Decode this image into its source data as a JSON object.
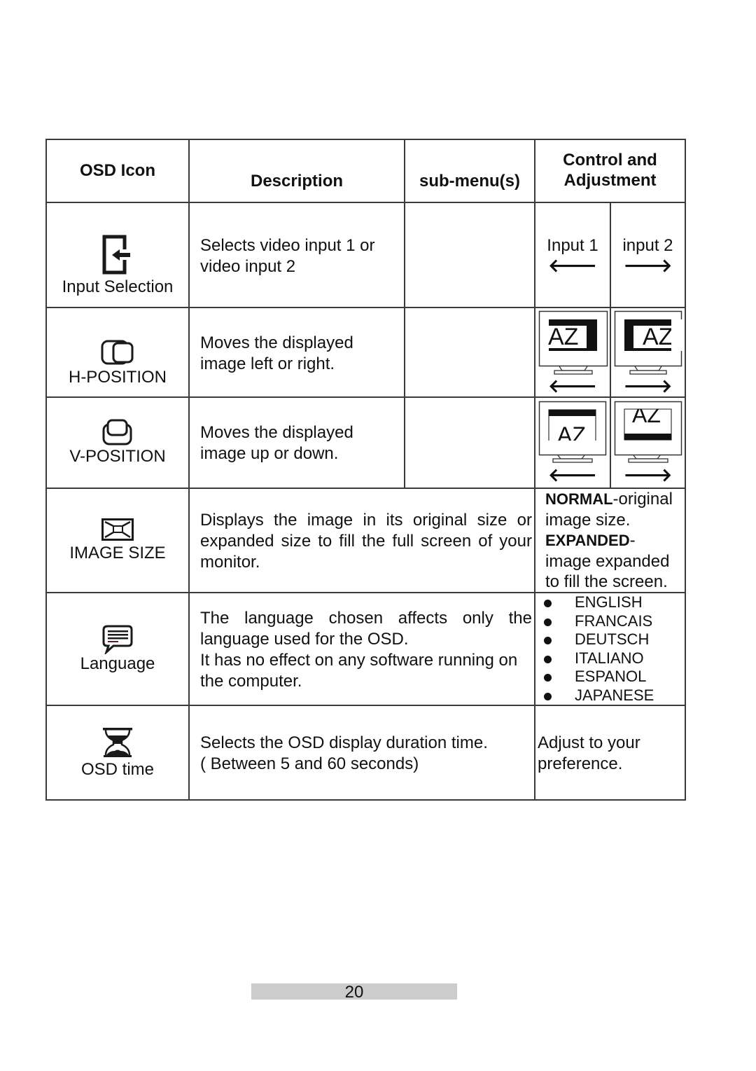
{
  "table": {
    "headers": {
      "osd_icon": "OSD Icon",
      "description": "Description",
      "submenus": "sub-menu(s)",
      "control_line1": "Control and",
      "control_line2": "Adjustment"
    },
    "rows": [
      {
        "icon": "input-selection-icon",
        "label": "Input Selection",
        "description_lines": [
          "Selects video input 1 or",
          "video input 2"
        ],
        "submenus": "",
        "controls": [
          {
            "label": "Input 1",
            "arrow": "🡐",
            "arrow_name": "left-arrow-icon"
          },
          {
            "label": "input 2",
            "arrow": "🡒",
            "arrow_name": "right-arrow-icon"
          }
        ]
      },
      {
        "icon": "h-position-icon",
        "label": "H-POSITION",
        "description_lines": [
          "Moves the displayed",
          "image left or right."
        ],
        "submenus": "",
        "controls": [
          {
            "illustration": "monitor-shifted-left",
            "screen_text": "AZ",
            "arrow": "🡐"
          },
          {
            "illustration": "monitor-shifted-right",
            "screen_text": "AZ",
            "arrow": "🡒"
          }
        ]
      },
      {
        "icon": "v-position-icon",
        "label": "V-POSITION",
        "description_lines": [
          "Moves the displayed",
          "image up or down."
        ],
        "submenus": "",
        "controls": [
          {
            "illustration": "monitor-shifted-down",
            "screen_text": "AZ",
            "arrow": "🡐"
          },
          {
            "illustration": "monitor-shifted-up",
            "screen_text": "AZ",
            "arrow": "🡒"
          }
        ]
      },
      {
        "icon": "image-size-icon",
        "label": "IMAGE SIZE",
        "description": "Displays the image in its original size or expanded size to fill the full screen of your monitor.",
        "control": {
          "normal_bold": "NORMAL",
          "normal_rest": "-original image size.",
          "expanded_bold": "EXPANDED",
          "expanded_rest": "- image expanded to fill the screen."
        }
      },
      {
        "icon": "language-icon",
        "label": "Language",
        "description_p1": "The language chosen affects only the language used for the OSD.",
        "description_p2": "It has no effect on any software running on the computer.",
        "languages": [
          "ENGLISH",
          "FRANCAIS",
          "DEUTSCH",
          "ITALIANO",
          "ESPANOL",
          "JAPANESE"
        ]
      },
      {
        "icon": "osd-time-icon",
        "label": "OSD time",
        "description_lines": [
          "Selects the OSD display duration time.",
          "( Between 5 and 60 seconds)"
        ],
        "control_lines": [
          "Adjust to your",
          "preference."
        ]
      }
    ]
  },
  "footer": {
    "page_number": "20"
  }
}
